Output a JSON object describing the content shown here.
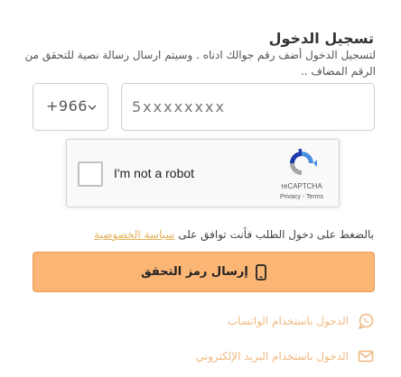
{
  "login": {
    "title": "تسجيل الدخول",
    "instructions": "لتسجيل الدخول أضف رقم جوالك ادناه . وسيتم ارسال رسالة نصية للتحقق من الرقم المضاف .."
  },
  "phone": {
    "country_code": "+966",
    "placeholder": "5xxxxxxxx"
  },
  "recaptcha": {
    "label": "I'm not a robot",
    "brand": "reCAPTCHA",
    "privacy": "Privacy",
    "separator": " - ",
    "terms": "Terms"
  },
  "terms_notice": {
    "text": "بالضغط على دخول الطلب فأنت توافق على ",
    "link": "سياسة الخصوصية"
  },
  "send_button": {
    "label": "إرسال رمز التحقق",
    "icon": "mobile-phone-icon"
  },
  "alt_login": {
    "whatsapp": {
      "label": "الدخول باستخدام الواتساب",
      "icon": "whatsapp-icon"
    },
    "email": {
      "label": "الدخول باستخدام البريد الإلكتروني",
      "icon": "envelope-icon"
    }
  },
  "colors": {
    "accent_button": "#fbb574",
    "accent_text": "#f0b980",
    "link": "#e3b25a"
  }
}
